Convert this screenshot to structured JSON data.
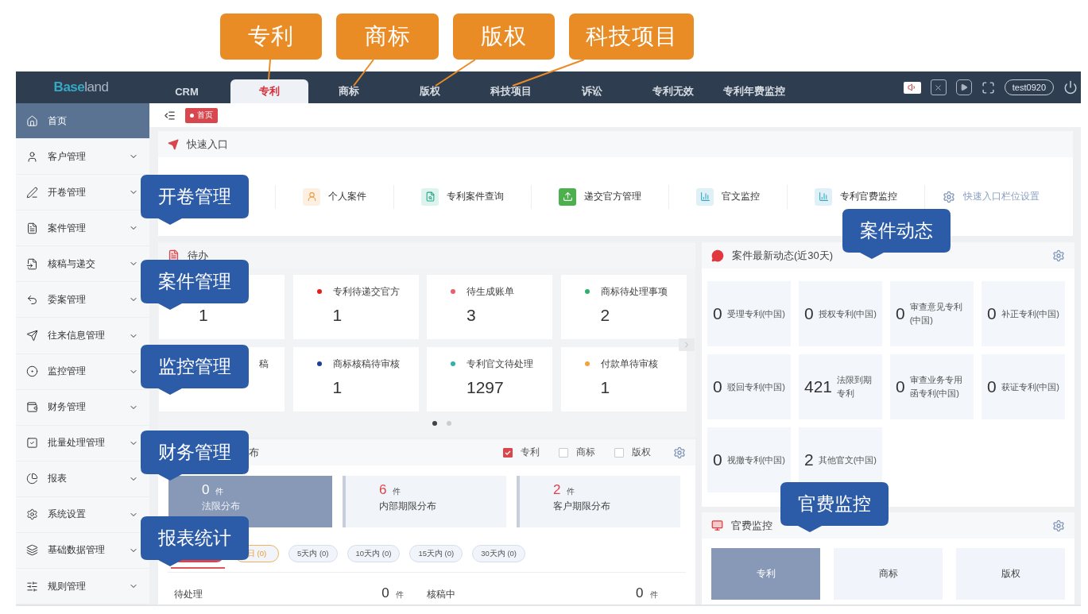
{
  "tab_callouts": [
    {
      "text": "专利"
    },
    {
      "text": "商标"
    },
    {
      "text": "版权"
    },
    {
      "text": "科技项目"
    }
  ],
  "header": {
    "logo_a": "Base",
    "logo_b": "land",
    "user": "test0920",
    "tabs": [
      {
        "label": "CRM",
        "selected": false
      },
      {
        "label": "专利",
        "selected": true
      },
      {
        "label": "商标",
        "selected": false
      },
      {
        "label": "版权",
        "selected": false
      },
      {
        "label": "科技项目",
        "selected": false
      },
      {
        "label": "诉讼",
        "selected": false
      },
      {
        "label": "专利无效",
        "selected": false
      },
      {
        "label": "专利年费监控",
        "selected": false
      }
    ]
  },
  "sidebar": {
    "items": [
      {
        "label": "首页",
        "selected": true,
        "expandable": false
      },
      {
        "label": "客户管理",
        "selected": false,
        "expandable": true
      },
      {
        "label": "开卷管理",
        "selected": false,
        "expandable": true
      },
      {
        "label": "案件管理",
        "selected": false,
        "expandable": true
      },
      {
        "label": "核稿与递交",
        "selected": false,
        "expandable": true
      },
      {
        "label": "委案管理",
        "selected": false,
        "expandable": true
      },
      {
        "label": "往来信息管理",
        "selected": false,
        "expandable": true
      },
      {
        "label": "监控管理",
        "selected": false,
        "expandable": true
      },
      {
        "label": "财务管理",
        "selected": false,
        "expandable": true
      },
      {
        "label": "批量处理管理",
        "selected": false,
        "expandable": true
      },
      {
        "label": "报表",
        "selected": false,
        "expandable": true
      },
      {
        "label": "系统设置",
        "selected": false,
        "expandable": true
      },
      {
        "label": "基础数据管理",
        "selected": false,
        "expandable": true
      },
      {
        "label": "规则管理",
        "selected": false,
        "expandable": true
      }
    ]
  },
  "breadcrumb": {
    "tag": "首页"
  },
  "quick_entry": {
    "title": "快速入口",
    "settings": "快速入口栏位设置",
    "items": [
      {
        "label": "个人案件",
        "kind": "person"
      },
      {
        "label": "专利案件查询",
        "kind": "search"
      },
      {
        "label": "递交官方管理",
        "kind": "upload"
      },
      {
        "label": "官文监控",
        "kind": "monitor"
      },
      {
        "label": "专利官费监控",
        "kind": "monitor"
      }
    ]
  },
  "todo": {
    "title": "待办",
    "cards": [
      {
        "value": "1"
      },
      {
        "label": "专利待递交官方",
        "color": "#e02020",
        "value": "1"
      },
      {
        "label": "待生成账单",
        "color": "#e8606a",
        "value": "3"
      },
      {
        "label": "商标待处理事项",
        "color": "#2fae6e",
        "value": "2"
      },
      {
        "label": "稿"
      },
      {
        "label": "商标核稿待审核",
        "color": "#1f3f9a",
        "value": "1"
      },
      {
        "label": "专利官文待处理",
        "color": "#2bb5a8",
        "value": "1297"
      },
      {
        "label": "付款单待审核",
        "color": "#f2a33a",
        "value": "1"
      }
    ],
    "pages": [
      {
        "selected": true
      },
      {
        "selected": false
      }
    ]
  },
  "deadlines": {
    "title": "布",
    "filters": [
      {
        "label": "专利",
        "checked": true
      },
      {
        "label": "商标",
        "checked": false
      },
      {
        "label": "版权",
        "checked": false
      }
    ],
    "stats": [
      {
        "value": "0",
        "unit": "件",
        "label": "法限分布",
        "selected": true
      },
      {
        "value": "6",
        "unit": "件",
        "label": "内部期限分布",
        "selected": false
      },
      {
        "value": "2",
        "unit": "件",
        "label": "客户期限分布",
        "selected": false
      }
    ],
    "chips": [
      {
        "kind": "active",
        "selected": true
      },
      {
        "label": "日 (0)",
        "kind": "warning",
        "selected": false
      },
      {
        "label": "5天内 (0)",
        "kind": "normal",
        "selected": false
      },
      {
        "label": "10天内 (0)",
        "kind": "normal",
        "selected": false
      },
      {
        "label": "15天内 (0)",
        "kind": "normal",
        "selected": false
      },
      {
        "label": "30天内 (0)",
        "kind": "normal",
        "selected": false
      }
    ],
    "rows": [
      {
        "label": "待处理",
        "value": "0",
        "unit": "件"
      },
      {
        "label": "核稿中",
        "value": "0",
        "unit": "件"
      }
    ]
  },
  "activity": {
    "title": "案件最新动态(近30天)",
    "items": [
      {
        "value": "0",
        "label": "受理专利(中国)"
      },
      {
        "value": "0",
        "label": "授权专利(中国)"
      },
      {
        "value": "0",
        "label": "审查意见专利(中国)"
      },
      {
        "value": "0",
        "label": "补正专利(中国)"
      },
      {
        "value": "0",
        "label": "驳回专利(中国)"
      },
      {
        "value": "421",
        "label": "法限到期专利"
      },
      {
        "value": "0",
        "label": "审查业务专用函专利(中国)"
      },
      {
        "value": "0",
        "label": "获证专利(中国)"
      },
      {
        "value": "0",
        "label": "视撤专利(中国)"
      },
      {
        "value": "2",
        "label": "其他官文(中国)"
      }
    ]
  },
  "fee_monitor": {
    "title": "官费监控",
    "tabs": [
      {
        "label": "专利",
        "selected": true
      },
      {
        "label": "商标",
        "selected": false
      },
      {
        "label": "版权",
        "selected": false
      }
    ]
  },
  "callouts": [
    {
      "text": "开卷管理"
    },
    {
      "text": "案件管理"
    },
    {
      "text": "监控管理"
    },
    {
      "text": "财务管理"
    },
    {
      "text": "报表统计"
    },
    {
      "text": "案件动态"
    },
    {
      "text": "官费监控"
    }
  ]
}
